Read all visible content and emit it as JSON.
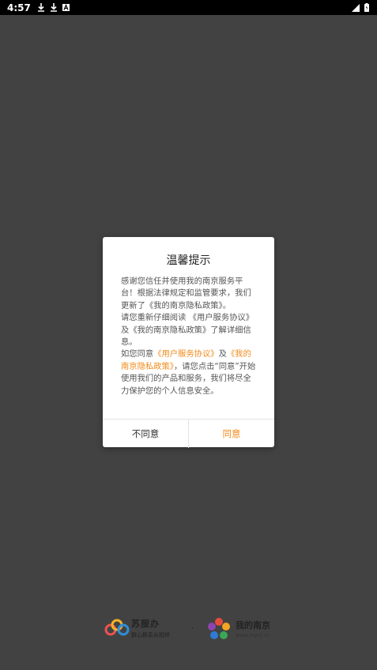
{
  "status_bar": {
    "time": "4:57"
  },
  "dialog": {
    "title": "温馨提示",
    "para1": "感谢您信任并使用我的南京服务平台！根据法律规定和监管要求，我们更新了《我的南京隐私政策》。",
    "para2": "请您重新仔细阅读 《用户服务协议》及《我的南京隐私政策》了解详细信息。",
    "para3_prefix": "如您同意",
    "para3_link1": "《用户服务协议》",
    "para3_and": "及",
    "para3_link2": "《我的南京隐私政策》",
    "para3_suffix": "，请您点击“同意”开始使用我们的产品和服务，我们将尽全力保护您的个人信息安全。",
    "disagree_label": "不同意",
    "agree_label": "同意"
  },
  "footer": {
    "logo1_name": "苏服办",
    "logo1_slogan": "群心群系长相伴",
    "separator": "·",
    "logo2_name": "我的南京",
    "logo2_url": "www.mynj.cn"
  },
  "colors": {
    "accent": "#f18a19",
    "background": "#424242"
  }
}
